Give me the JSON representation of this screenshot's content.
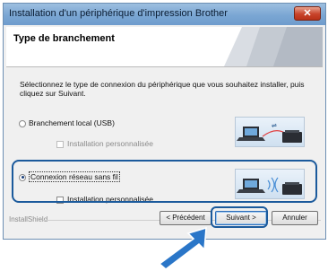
{
  "window": {
    "title": "Installation d'un périphérique d'impression Brother",
    "close_symbol": "✕"
  },
  "header": {
    "title": "Type de branchement"
  },
  "instructions": "Sélectionnez le type de connexion du périphérique que vous souhaitez installer, puis cliquez sur Suivant.",
  "options": {
    "usb": {
      "label": "Branchement local (USB)",
      "selected": false,
      "custom_label": "Installation personnalisée",
      "custom_enabled": false
    },
    "wireless": {
      "label": "Connexion réseau sans fil",
      "selected": true,
      "custom_label": "Installation personnalisée",
      "custom_enabled": true
    }
  },
  "footer": {
    "brand": "InstallShield"
  },
  "buttons": {
    "back": "< Précédent",
    "next": "Suivant >",
    "cancel": "Annuler"
  },
  "colors": {
    "highlight": "#1b5a9c",
    "arrow": "#2a76c8"
  },
  "icons": {
    "usb_picture": "laptop-usb-printer-icon",
    "wireless_picture": "laptop-wireless-printer-icon",
    "pointer": "arrow-pointer-icon"
  }
}
